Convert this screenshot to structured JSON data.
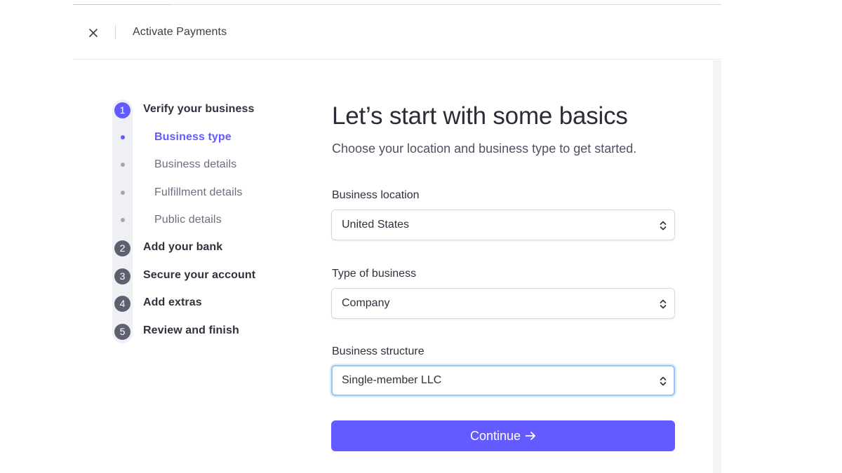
{
  "header": {
    "title": "Activate Payments"
  },
  "stepper": {
    "steps": [
      {
        "number": "1",
        "label": "Verify your business",
        "substeps": [
          "Business type",
          "Business details",
          "Fulfillment details",
          "Public details"
        ]
      },
      {
        "number": "2",
        "label": "Add your bank"
      },
      {
        "number": "3",
        "label": "Secure your account"
      },
      {
        "number": "4",
        "label": "Add extras"
      },
      {
        "number": "5",
        "label": "Review and finish"
      }
    ],
    "active_step": "1",
    "active_substep": "Business type"
  },
  "form": {
    "heading": "Let’s start with some basics",
    "subheading": "Choose your location and business type to get started.",
    "location": {
      "label": "Business location",
      "value": "United States"
    },
    "business_type": {
      "label": "Type of business",
      "value": "Company"
    },
    "structure": {
      "label": "Business structure",
      "value": "Single-member LLC"
    },
    "continue_label": "Continue"
  },
  "colors": {
    "accent": "#635bff",
    "focus_ring": "#9fc6ee",
    "step_inactive": "#5c6170"
  },
  "icons": {
    "close": "close-icon",
    "select": "chevron-up-down-icon",
    "continue": "arrow-right-icon"
  }
}
